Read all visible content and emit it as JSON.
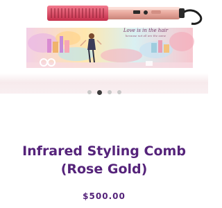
{
  "product": {
    "image_alt": "Infrared styling comb in rose gold on printed box",
    "box_text_line1": "Love is in the hair",
    "box_text_line2": "because not all are the same",
    "title_line1": "Infrared Styling Comb",
    "title_line2": "(Rose Gold)",
    "price": "$500.00",
    "colors": {
      "title": "#55237a",
      "rose_gold": "#e8a89d",
      "handle": "#d8455f"
    }
  },
  "carousel": {
    "total": 4,
    "active": 2
  }
}
